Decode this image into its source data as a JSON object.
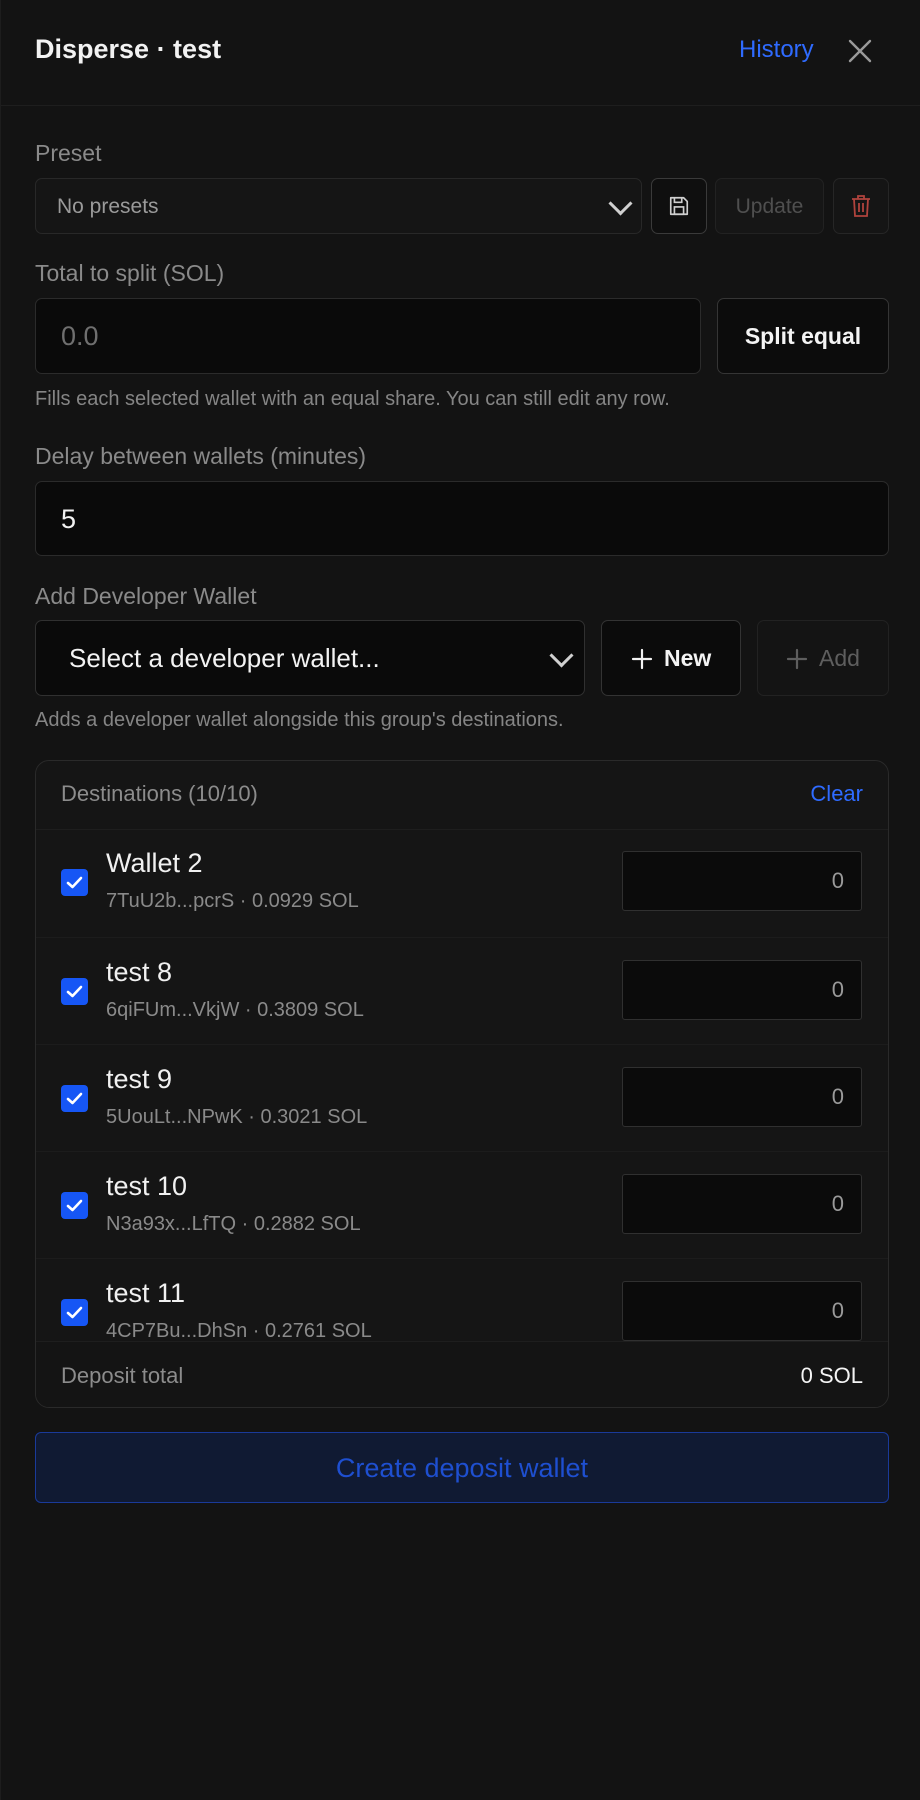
{
  "header": {
    "title": "Disperse · test",
    "history_label": "History"
  },
  "preset": {
    "label": "Preset",
    "selected": "No presets",
    "update_label": "Update"
  },
  "total": {
    "label": "Total to split (SOL)",
    "placeholder": "0.0",
    "split_label": "Split equal",
    "help": "Fills each selected wallet with an equal share. You can still edit any row."
  },
  "delay": {
    "label": "Delay between wallets (minutes)",
    "value": "5"
  },
  "developer": {
    "label": "Add Developer Wallet",
    "selected": "Select a developer wallet...",
    "new_label": "New",
    "add_label": "Add",
    "help": "Adds a developer wallet alongside this group's destinations."
  },
  "destinations": {
    "title": "Destinations (10/10)",
    "clear_label": "Clear",
    "rows": [
      {
        "name": "Wallet 2",
        "sub": "7TuU2b...pcrS · 0.0929 SOL",
        "amount": "0"
      },
      {
        "name": "test 8",
        "sub": "6qiFUm...VkjW · 0.3809 SOL",
        "amount": "0"
      },
      {
        "name": "test 9",
        "sub": "5UouLt...NPwK · 0.3021 SOL",
        "amount": "0"
      },
      {
        "name": "test 10",
        "sub": "N3a93x...LfTQ · 0.2882 SOL",
        "amount": "0"
      },
      {
        "name": "test 11",
        "sub": "4CP7Bu...DhSn · 0.2761 SOL",
        "amount": "0"
      }
    ],
    "footer_label": "Deposit total",
    "footer_value": "0 SOL"
  },
  "create_label": "Create deposit wallet",
  "colors": {
    "accent": "#2f6bff",
    "checkbox": "#1656f5",
    "background": "#131313"
  }
}
